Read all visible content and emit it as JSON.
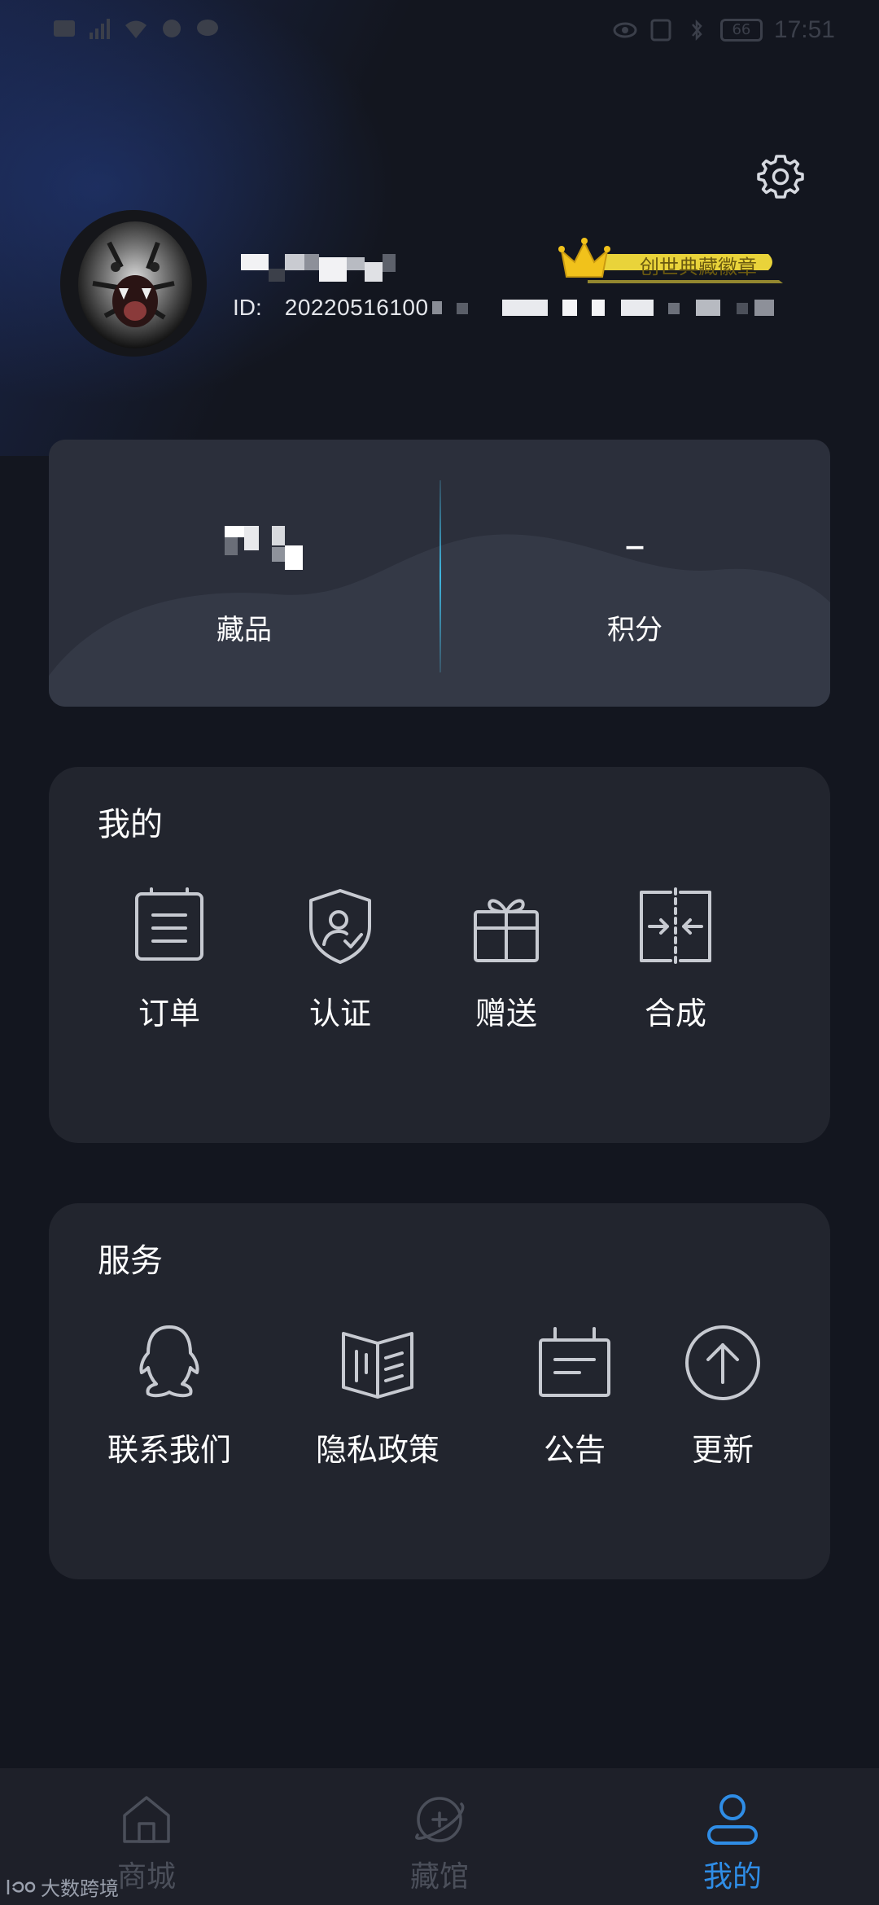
{
  "status_bar": {
    "time": "17:51",
    "battery": "66"
  },
  "profile": {
    "id_label": "ID:",
    "id_value": "20220516100",
    "badge_text": "创世典藏徽章"
  },
  "stats": [
    {
      "value": "",
      "label": "藏品"
    },
    {
      "value": "–",
      "label": "积分"
    }
  ],
  "mine": {
    "title": "我的",
    "items": [
      {
        "label": "订单",
        "icon": "order-icon"
      },
      {
        "label": "认证",
        "icon": "verify-icon"
      },
      {
        "label": "赠送",
        "icon": "gift-icon"
      },
      {
        "label": "合成",
        "icon": "merge-icon"
      }
    ]
  },
  "services": {
    "title": "服务",
    "items": [
      {
        "label": "联系我们",
        "icon": "qq-icon"
      },
      {
        "label": "隐私政策",
        "icon": "book-icon"
      },
      {
        "label": "公告",
        "icon": "notice-icon"
      },
      {
        "label": "更新",
        "icon": "update-icon"
      }
    ]
  },
  "tabs": [
    {
      "label": "商城",
      "icon": "home-icon",
      "active": false
    },
    {
      "label": "藏馆",
      "icon": "planet-icon",
      "active": false
    },
    {
      "label": "我的",
      "icon": "user-icon",
      "active": true
    }
  ],
  "watermark": "大数跨境",
  "colors": {
    "accent": "#2f8de6",
    "card": "#22252e",
    "background": "#13161f",
    "badge": "#e9d33a"
  }
}
